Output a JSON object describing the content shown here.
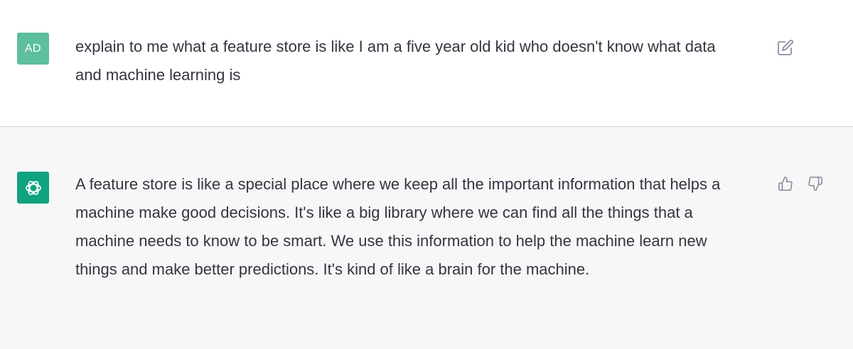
{
  "conversation": {
    "user_message": {
      "avatar_initials": "AD",
      "text": "explain to me what a feature store is like I am a five year old kid who doesn't know what data and machine learning is"
    },
    "assistant_message": {
      "text": "A feature store is like a special place where we keep all the important information that helps a machine make good decisions. It's like a big library where we can find all the things that a machine needs to know to be smart. We use this information to help the machine learn new things and make better predictions. It's kind of like a brain for the machine."
    }
  },
  "icons": {
    "edit": "edit-icon",
    "thumbs_up": "thumbs-up-icon",
    "thumbs_down": "thumbs-down-icon",
    "assistant_logo": "openai-logo-icon"
  },
  "colors": {
    "user_avatar_bg": "#5dbf9c",
    "assistant_avatar_bg": "#10a37f",
    "assistant_row_bg": "#f7f7f8",
    "text": "#343541",
    "icon": "#8e8ea0"
  }
}
